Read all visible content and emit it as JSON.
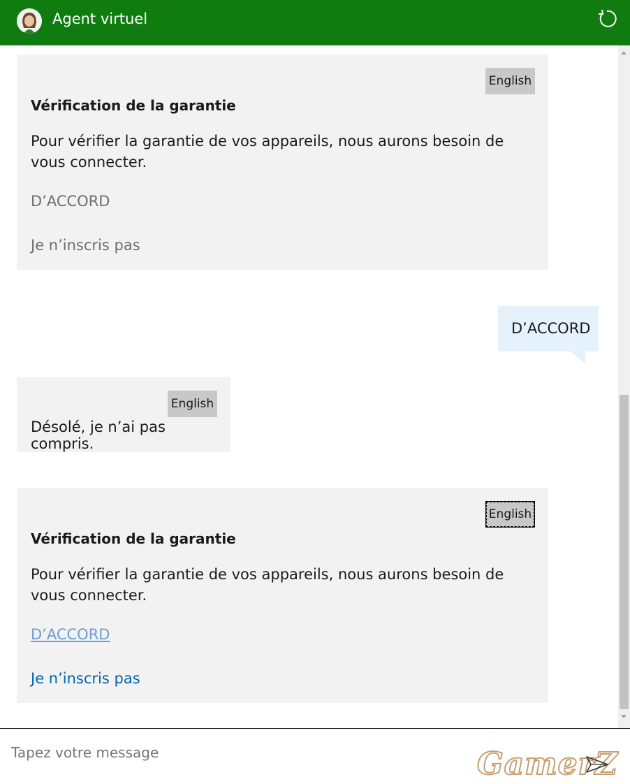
{
  "header": {
    "title": "Agent virtuel"
  },
  "messages": {
    "card1": {
      "lang_button": "English",
      "title": "Vérification de la garantie",
      "body": "Pour vérifier la garantie de vos appareils, nous aurons besoin de vous connecter.",
      "action_ok": "D’ACCORD",
      "action_decline": "Je n’inscris pas"
    },
    "user_reply": "D’ACCORD",
    "bot_reply": {
      "lang_button": "English",
      "text": "Désolé, je n’ai pas compris."
    },
    "card2": {
      "lang_button": "English",
      "title": "Vérification de la garantie",
      "body": "Pour vérifier la garantie de vos appareils, nous aurons besoin de vous connecter.",
      "action_ok": "D’ACCORD",
      "action_decline": "Je n’inscris pas"
    }
  },
  "composer": {
    "placeholder": "Tapez votre message"
  },
  "watermark": "GamerZ",
  "colors": {
    "header": "#107c10",
    "card": "#f2f2f2",
    "user_bubble": "#e5f1fb",
    "link": "#0063b1"
  }
}
